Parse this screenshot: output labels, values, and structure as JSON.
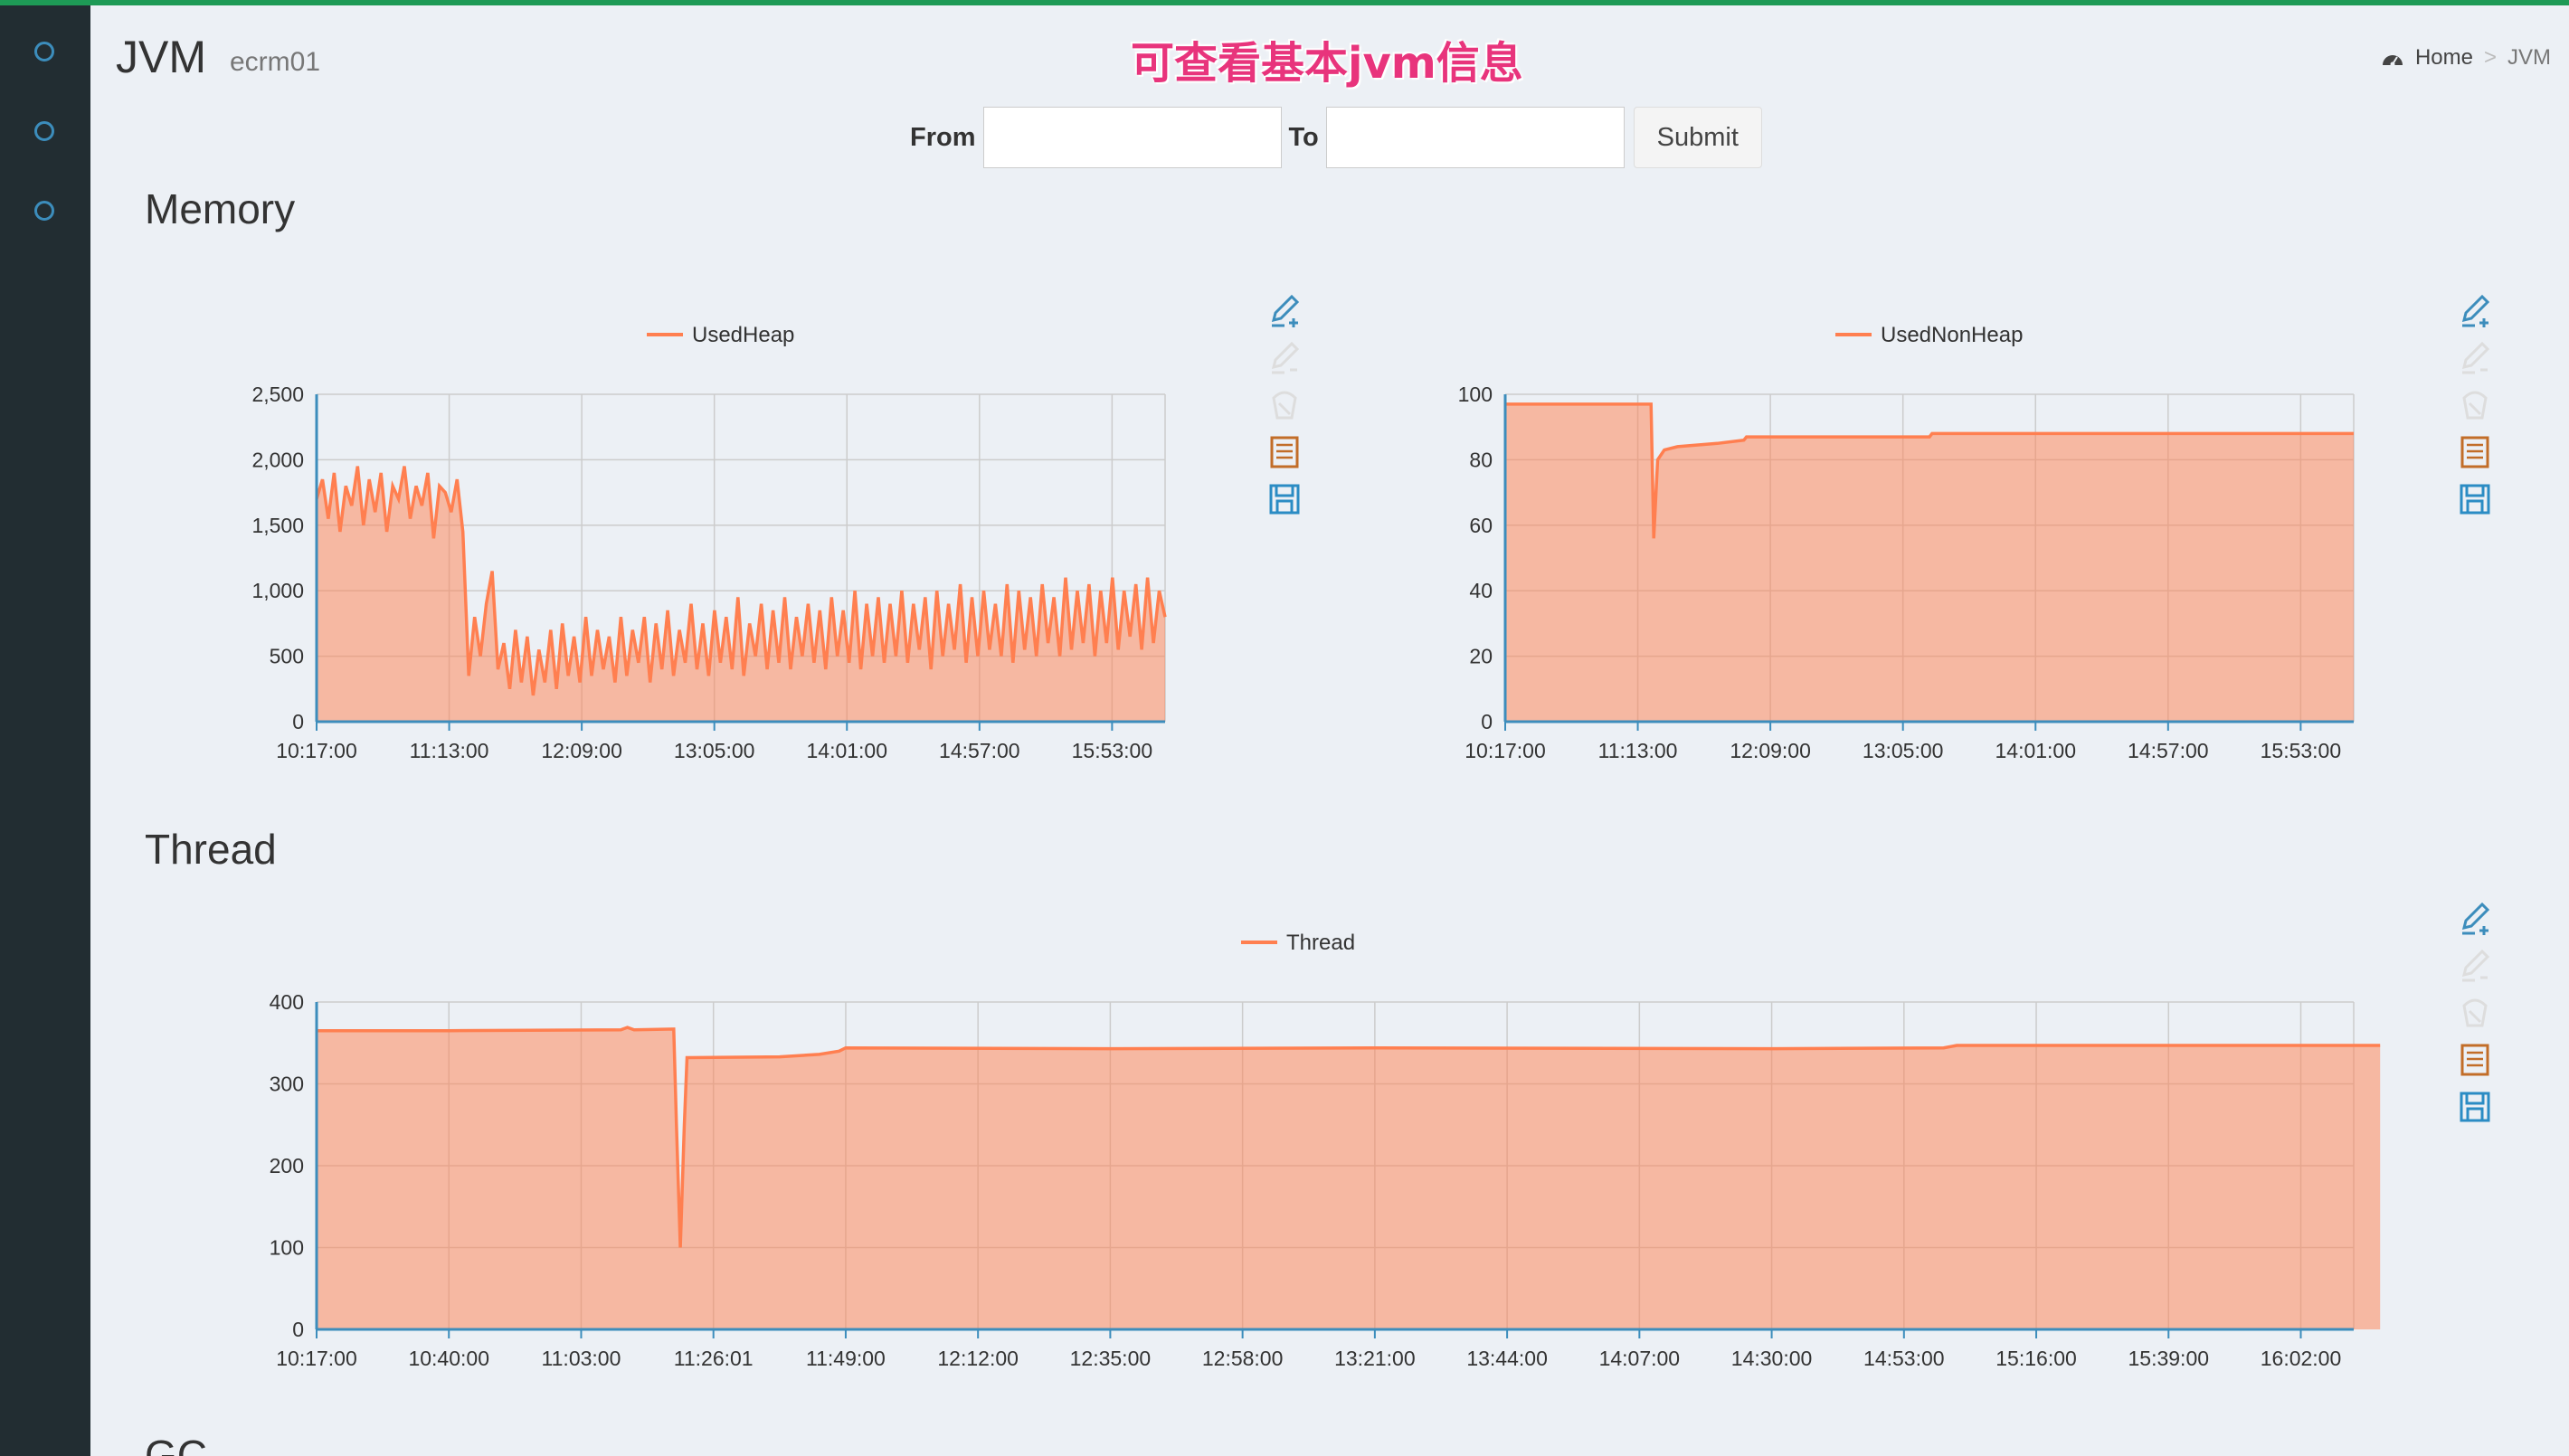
{
  "header": {
    "title": "JVM",
    "subtitle": "ecrm01",
    "annotation": "可查看基本jvm信息"
  },
  "breadcrumb": {
    "home": "Home",
    "separator": ">",
    "current": "JVM"
  },
  "filter": {
    "from_label": "From",
    "from_value": "",
    "to_label": "To",
    "to_value": "",
    "submit_label": "Submit"
  },
  "sections": {
    "memory": "Memory",
    "thread": "Thread",
    "gc": "GC"
  },
  "colors": {
    "series": "#ff7f50",
    "axis": "#3c8dbc",
    "grid": "#cccccc",
    "sidebar": "#222d32",
    "topline": "#1e9a56"
  },
  "sidebar_icons": [
    "circle-icon",
    "circle-icon",
    "circle-icon"
  ],
  "toolbox_icons": [
    "line-edit-icon",
    "edit-disabled-icon",
    "clear-disabled-icon",
    "data-view-icon",
    "save-image-icon"
  ],
  "chart_data": [
    {
      "id": "used-heap",
      "type": "area",
      "legend": [
        "UsedHeap"
      ],
      "legend_position": "top-center",
      "grid": true,
      "x_ticks": [
        "10:17:00",
        "11:13:00",
        "12:09:00",
        "13:05:00",
        "14:01:00",
        "14:57:00",
        "15:53:00"
      ],
      "y_ticks": [
        "0",
        "500",
        "1,000",
        "1,500",
        "2,000",
        "2,500"
      ],
      "ylim": [
        0,
        2500
      ],
      "series": [
        {
          "name": "UsedHeap",
          "x_ticks_span": [
            0,
            6.4
          ],
          "values": [
            1700,
            1850,
            1550,
            1900,
            1450,
            1800,
            1650,
            1950,
            1500,
            1850,
            1600,
            1900,
            1450,
            1800,
            1700,
            1950,
            1550,
            1800,
            1650,
            1900,
            1400,
            1800,
            1750,
            1600,
            1850,
            1450,
            350,
            800,
            500,
            900,
            1150,
            400,
            600,
            250,
            700,
            300,
            650,
            200,
            550,
            300,
            700,
            250,
            750,
            350,
            650,
            300,
            800,
            350,
            700,
            400,
            650,
            300,
            800,
            350,
            700,
            450,
            800,
            300,
            750,
            400,
            850,
            350,
            700,
            450,
            900,
            400,
            750,
            350,
            850,
            450,
            800,
            400,
            950,
            350,
            750,
            500,
            900,
            400,
            850,
            450,
            950,
            400,
            800,
            500,
            900,
            450,
            850,
            400,
            950,
            500,
            850,
            450,
            1000,
            400,
            900,
            500,
            950,
            450,
            900,
            500,
            1000,
            450,
            900,
            550,
            950,
            400,
            1000,
            500,
            900,
            550,
            1050,
            450,
            950,
            500,
            1000,
            550,
            900,
            500,
            1050,
            450,
            1000,
            550,
            950,
            500,
            1050,
            600,
            950,
            500,
            1100,
            550,
            1000,
            600,
            1050,
            500,
            1000,
            600,
            1100,
            550,
            1000,
            650,
            1050,
            550,
            1100,
            600,
            1000,
            800
          ]
        }
      ]
    },
    {
      "id": "used-non-heap",
      "type": "area",
      "legend": [
        "UsedNonHeap"
      ],
      "legend_position": "top-center",
      "grid": true,
      "x_ticks": [
        "10:17:00",
        "11:13:00",
        "12:09:00",
        "13:05:00",
        "14:01:00",
        "14:57:00",
        "15:53:00"
      ],
      "y_ticks": [
        "0",
        "20",
        "40",
        "60",
        "80",
        "100"
      ],
      "ylim": [
        0,
        100
      ],
      "series": [
        {
          "name": "UsedNonHeap",
          "points": [
            [
              0,
              97
            ],
            [
              1.1,
              97
            ],
            [
              1.12,
              56
            ],
            [
              1.15,
              80
            ],
            [
              1.2,
              83
            ],
            [
              1.3,
              84
            ],
            [
              1.6,
              85
            ],
            [
              1.8,
              86
            ],
            [
              1.82,
              87
            ],
            [
              3.2,
              87
            ],
            [
              3.22,
              88
            ],
            [
              6.4,
              88
            ]
          ]
        }
      ]
    },
    {
      "id": "thread",
      "type": "area",
      "legend": [
        "Thread"
      ],
      "legend_position": "top-center",
      "grid": true,
      "x_ticks": [
        "10:17:00",
        "10:40:00",
        "11:03:00",
        "11:26:01",
        "11:49:00",
        "12:12:00",
        "12:35:00",
        "12:58:00",
        "13:21:00",
        "13:44:00",
        "14:07:00",
        "14:30:00",
        "14:53:00",
        "15:16:00",
        "15:39:00",
        "16:02:00"
      ],
      "y_ticks": [
        "0",
        "100",
        "200",
        "300",
        "400"
      ],
      "ylim": [
        0,
        400
      ],
      "series": [
        {
          "name": "Thread",
          "points": [
            [
              0,
              365
            ],
            [
              1.0,
              365
            ],
            [
              2.3,
              366
            ],
            [
              2.35,
              369
            ],
            [
              2.4,
              366
            ],
            [
              2.7,
              367
            ],
            [
              2.72,
              250
            ],
            [
              2.75,
              100
            ],
            [
              2.78,
              250
            ],
            [
              2.8,
              332
            ],
            [
              3.5,
              333
            ],
            [
              3.8,
              336
            ],
            [
              3.95,
              340
            ],
            [
              4.0,
              344
            ],
            [
              6.0,
              343
            ],
            [
              8.0,
              344
            ],
            [
              11.0,
              343
            ],
            [
              12.3,
              344
            ],
            [
              12.4,
              347
            ],
            [
              15.6,
              347
            ]
          ]
        }
      ]
    }
  ]
}
